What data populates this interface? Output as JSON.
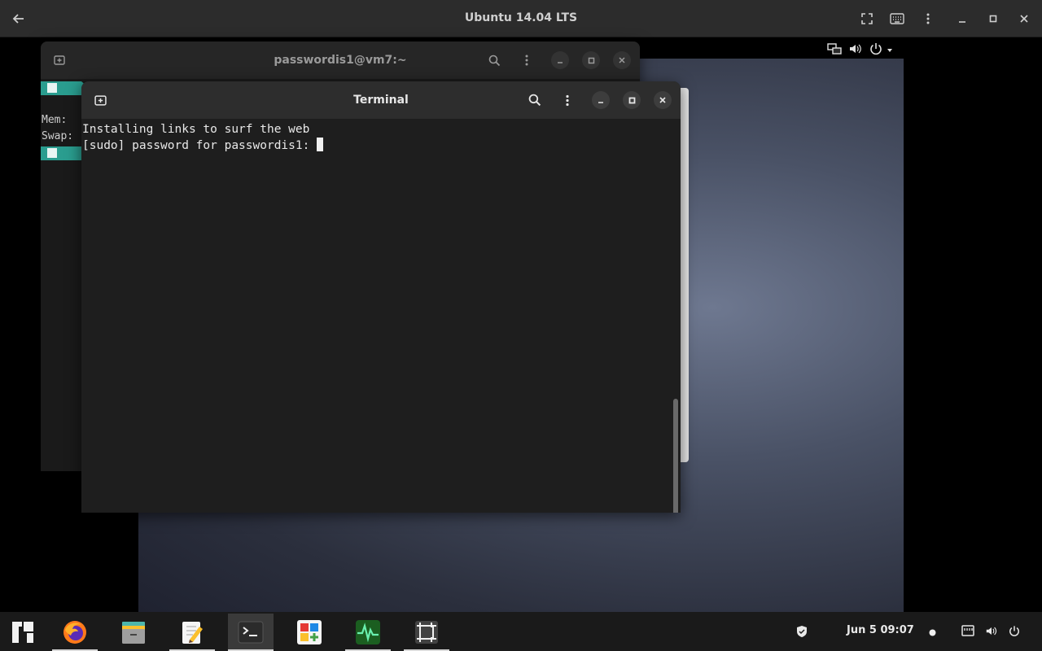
{
  "host": {
    "title": "Ubuntu 14.04 LTS",
    "icons": [
      "back-arrow-icon",
      "fullscreen-icon",
      "keyboard-icon",
      "more-vert-icon",
      "minimize-icon",
      "maximize-icon",
      "close-icon"
    ]
  },
  "tray": {
    "icons": [
      "network-icon",
      "volume-icon",
      "power-icon",
      "dropdown-arrow-icon"
    ]
  },
  "back_window": {
    "title": "passwordis1@vm7:~",
    "lines": [
      "Mem:",
      "Swap:"
    ]
  },
  "front_window": {
    "title": "Terminal",
    "lines": [
      "Installing links to surf the web",
      "[sudo] password for passwordis1: "
    ]
  },
  "taskbar": {
    "apps": [
      "Menu",
      "Firefox",
      "Files",
      "Text Editor",
      "Terminal",
      "Software",
      "System Monitor",
      "Screenshot"
    ],
    "clock": "Jun 5  09:07",
    "indicators": [
      "shield-icon",
      "dot-icon",
      "network-icon",
      "volume-icon",
      "power-icon"
    ]
  },
  "colors": {
    "accent_teal": "#2a9d8f",
    "panel_bg": "#2c2c2c",
    "terminal_bg": "#1e1e1e"
  }
}
